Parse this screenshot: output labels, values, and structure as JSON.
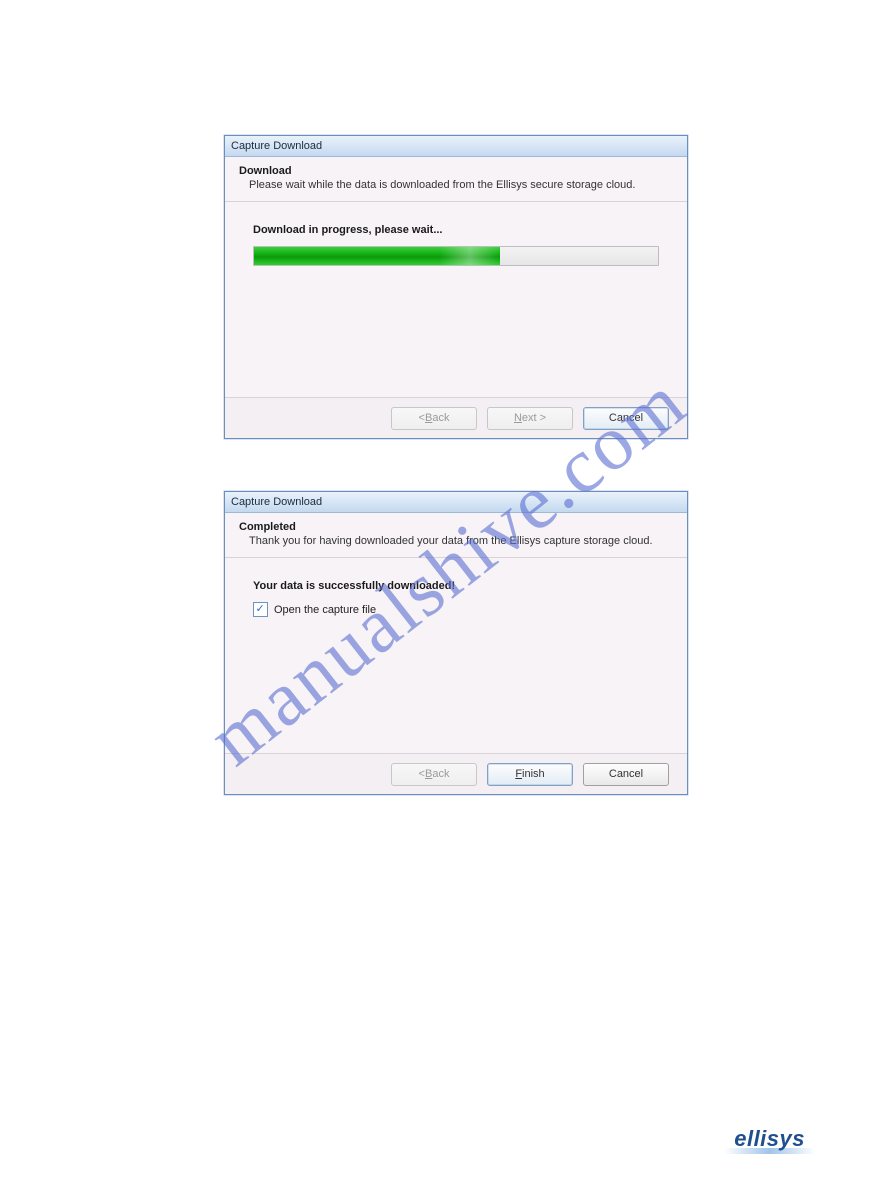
{
  "watermark": "manualshive.com",
  "brand": "ellisys",
  "dialog1": {
    "title": "Capture Download",
    "heading": "Download",
    "subheading": "Please wait while the data is downloaded from the Ellisys secure storage cloud.",
    "status": "Download in progress, please wait...",
    "progress_percent": 61,
    "buttons": {
      "back_prefix": "< ",
      "back_m": "B",
      "back_suffix": "ack",
      "next_m": "N",
      "next_suffix": "ext >",
      "cancel": "Cancel"
    }
  },
  "dialog2": {
    "title": "Capture Download",
    "heading": "Completed",
    "subheading": "Thank you for having downloaded your data from the Ellisys capture storage cloud.",
    "status": "Your data is successfully downloaded!",
    "checkbox_label": "Open the capture file",
    "checkbox_checked": true,
    "buttons": {
      "back_prefix": "< ",
      "back_m": "B",
      "back_suffix": "ack",
      "finish_m": "F",
      "finish_suffix": "inish",
      "cancel": "Cancel"
    }
  }
}
